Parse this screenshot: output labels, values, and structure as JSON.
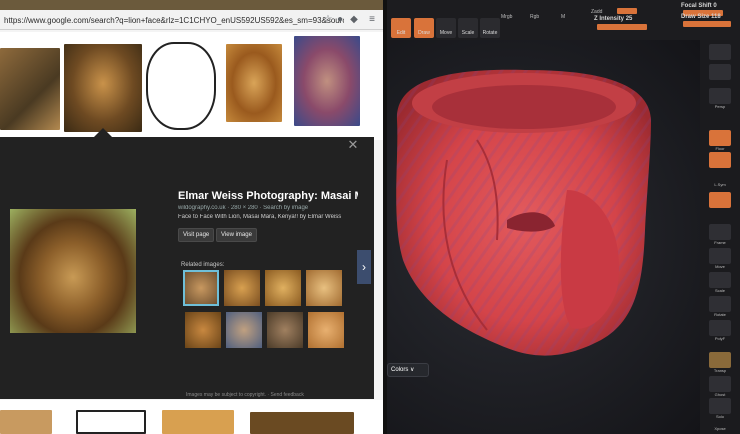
{
  "browser": {
    "url": "https://www.google.com/search?q=lion+face&rlz=1C1CHYO_enUS592US592&es_sm=93&source=lnms",
    "panel": {
      "title": "Elmar Weiss Photography: Masai Ma...",
      "source": "wildography.co.uk · 280 × 280 · Search by image",
      "description": "Face to Face With Lion, Masai Mara, Kenya!! by Elmar Weiss",
      "visit_button": "Visit page",
      "view_button": "View image",
      "related_label": "Related images:",
      "footer": "Images may be subject to copyright. · Send feedback",
      "close_glyph": "✕",
      "next_glyph": "›"
    },
    "icons": [
      "star-icon",
      "microphone-icon",
      "shield-icon",
      "menu-icon"
    ]
  },
  "zbrush": {
    "tools": [
      "Edit",
      "Draw",
      "Move",
      "Scale",
      "Rotate"
    ],
    "top_labels": {
      "mrgb": "Mrgb",
      "rgb": "Rgb",
      "m": "M",
      "zadd": "Zadd",
      "zsub": "Zsub",
      "z_intensity_label": "Z Intensity",
      "z_intensity_value": "25",
      "focal_label": "Focal Shift",
      "focal_value": "0",
      "draw_size_label": "Draw Size",
      "draw_size_value": "118"
    },
    "colors_tab": "Colors",
    "shelf": [
      "Persp",
      "Floor",
      "L.Sym",
      "Frame",
      "Move",
      "Scale",
      "Rotate",
      "PolyF",
      "Transp",
      "Ghost",
      "Solo",
      "Xpose"
    ],
    "brand_color": "#d9733a",
    "model_color": "#d94a4f"
  }
}
